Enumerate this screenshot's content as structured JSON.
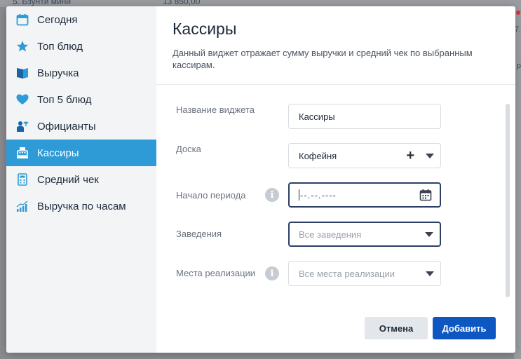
{
  "background": {
    "row_left": "5. Бзунти мини",
    "row_value": "13 850,00",
    "edge_text_1": "7.",
    "edge_text_2": "р"
  },
  "sidebar": {
    "items": [
      {
        "label": "Сегодня",
        "icon": "calendar-icon"
      },
      {
        "label": "Топ блюд",
        "icon": "star-icon"
      },
      {
        "label": "Выручка",
        "icon": "book-icon"
      },
      {
        "label": "Топ 5 блюд",
        "icon": "heart-icon"
      },
      {
        "label": "Официанты",
        "icon": "waiter-icon"
      },
      {
        "label": "Кассиры",
        "icon": "cash-register-icon",
        "active": true
      },
      {
        "label": "Средний чек",
        "icon": "calculator-icon"
      },
      {
        "label": "Выручка по часам",
        "icon": "bar-chart-icon"
      }
    ]
  },
  "main": {
    "title": "Кассиры",
    "description": "Данный виджет отражает сумму выручки и средний чек по выбранным кассирам."
  },
  "form": {
    "widget_name": {
      "label": "Название виджета",
      "value": "Кассиры"
    },
    "board": {
      "label": "Доска",
      "value": "Кофейня"
    },
    "period_start": {
      "label": "Начало периода",
      "value": "--.--.----"
    },
    "venues": {
      "label": "Заведения",
      "placeholder": "Все заведения"
    },
    "sale_points": {
      "label": "Места реализации",
      "placeholder": "Все места реализации"
    }
  },
  "buttons": {
    "cancel": "Отмена",
    "add": "Добавить"
  },
  "colors": {
    "accent": "#2e9bd6",
    "primary_button": "#0e57c2",
    "focus_border": "#2b3f66"
  }
}
